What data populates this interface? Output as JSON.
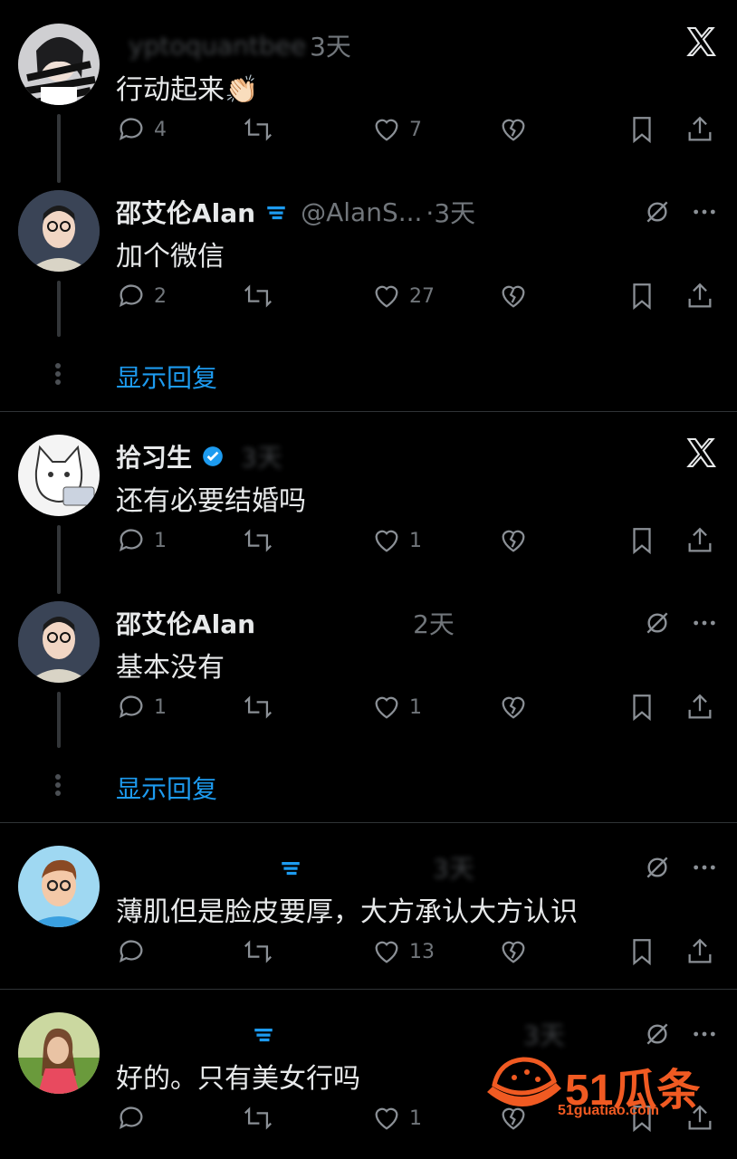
{
  "tweets": [
    {
      "name": "",
      "handle": "yptoquantbee",
      "time": "3天",
      "text": "行动起来👏🏻",
      "counts": {
        "reply": "4",
        "retweet": "",
        "like": "7"
      },
      "corner": "x-logo"
    },
    {
      "name": "邵艾伦Alan",
      "handle": "@AlanS...",
      "time": "·3天",
      "text": "加个微信",
      "counts": {
        "reply": "2",
        "retweet": "",
        "like": "27"
      },
      "corner": "mute-more"
    },
    {
      "name": "拾习生",
      "handle": "",
      "time": "3天",
      "text": "还有必要结婚吗",
      "counts": {
        "reply": "1",
        "retweet": "",
        "like": "1"
      },
      "corner": "x-logo"
    },
    {
      "name": "邵艾伦Alan",
      "handle": "",
      "time": "2天",
      "text": "基本没有",
      "counts": {
        "reply": "1",
        "retweet": "",
        "like": "1"
      },
      "corner": "mute-more"
    },
    {
      "name": "",
      "handle": "",
      "time": "3天",
      "text": "薄肌但是脸皮要厚，大方承认大方认识",
      "counts": {
        "reply": "",
        "retweet": "",
        "like": "13"
      },
      "corner": "mute-more"
    },
    {
      "name": "",
      "handle": "",
      "time": "3天",
      "text": "好的。只有美女行吗",
      "counts": {
        "reply": "",
        "retweet": "",
        "like": "1"
      },
      "corner": "mute-more"
    }
  ],
  "show_replies_label": "显示回复",
  "watermark": {
    "brand": "51瓜条",
    "url": "51guatiao.com"
  },
  "colors": {
    "background": "#000000",
    "text": "#e7e9ea",
    "muted": "#71767b",
    "link": "#1d9bf0",
    "watermark": "#f05a22"
  }
}
